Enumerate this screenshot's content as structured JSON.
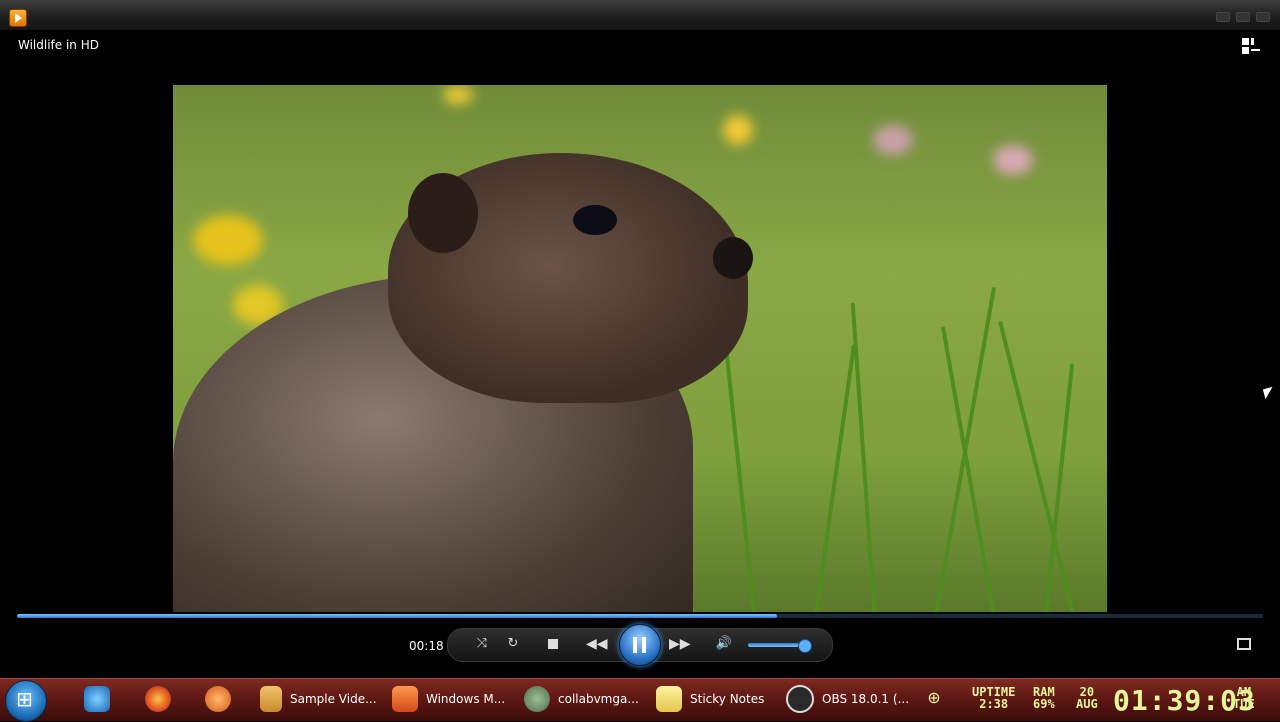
{
  "window": {
    "video_title": "Wildlife in HD"
  },
  "player": {
    "elapsed_time": "00:18",
    "progress_fraction": 0.61,
    "volume_fraction": 0.9,
    "icons": [
      "shuffle-icon",
      "repeat-icon",
      "stop-icon",
      "previous-icon",
      "pause-icon",
      "next-icon",
      "volume-icon",
      "fullscreen-icon",
      "switch-to-library-icon"
    ]
  },
  "taskbar": {
    "items": [
      {
        "label": "Sample Vide..."
      },
      {
        "label": "Windows M..."
      },
      {
        "label": "collabvmga..."
      },
      {
        "label": "Sticky Notes"
      },
      {
        "label": "OBS 18.0.1 (..."
      }
    ],
    "clock": {
      "uptime_label": "UPTIME",
      "uptime_value": "2:38",
      "ram_label": "RAM",
      "ram_value": "69%",
      "day": "20",
      "month": "AUG",
      "time": "01:39:03",
      "ampm": "AM",
      "weekday": "TUE"
    }
  },
  "colors": {
    "accent": "#2b7ad0",
    "taskbar": "#5c1712"
  }
}
